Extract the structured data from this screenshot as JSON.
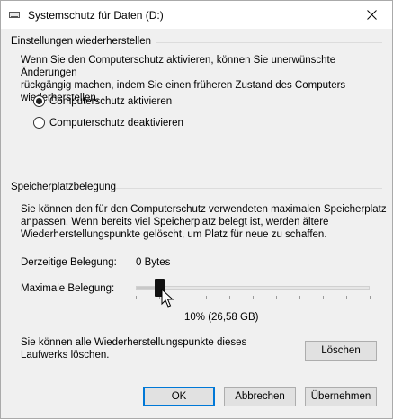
{
  "window": {
    "title": "Systemschutz für Daten (D:)"
  },
  "restore": {
    "section_title": "Einstellungen wiederherstellen",
    "description_lines": [
      "Wenn Sie den Computerschutz aktivieren, können Sie unerwünschte Änderungen",
      "rückgängig machen, indem Sie einen früheren Zustand des Computers",
      "wiederherstellen."
    ],
    "options": [
      {
        "label": "Computerschutz aktivieren",
        "checked": true
      },
      {
        "label": "Computerschutz deaktivieren",
        "checked": false
      }
    ]
  },
  "storage": {
    "section_title": "Speicherplatzbelegung",
    "description_lines": [
      "Sie können den für den Computerschutz verwendeten maximalen Speicherplatz",
      "anpassen. Wenn bereits viel Speicherplatz belegt ist, werden ältere",
      "Wiederherstellungspunkte gelöscht, um Platz für neue zu schaffen."
    ],
    "current_label": "Derzeitige Belegung:",
    "current_value": "0 Bytes",
    "max_label": "Maximale Belegung:",
    "slider_value_fraction": 0.1,
    "slider_readout": "10% (26,58 GB)"
  },
  "delete": {
    "description_lines": [
      "Sie können alle Wiederherstellungspunkte dieses",
      "Laufwerks löschen."
    ],
    "button_label": "Löschen"
  },
  "footer": {
    "ok_label": "OK",
    "cancel_label": "Abbrechen",
    "apply_label": "Übernehmen"
  },
  "colors": {
    "accent": "#0078d7",
    "thumb": "#111111",
    "background": "#f0f0f0"
  }
}
